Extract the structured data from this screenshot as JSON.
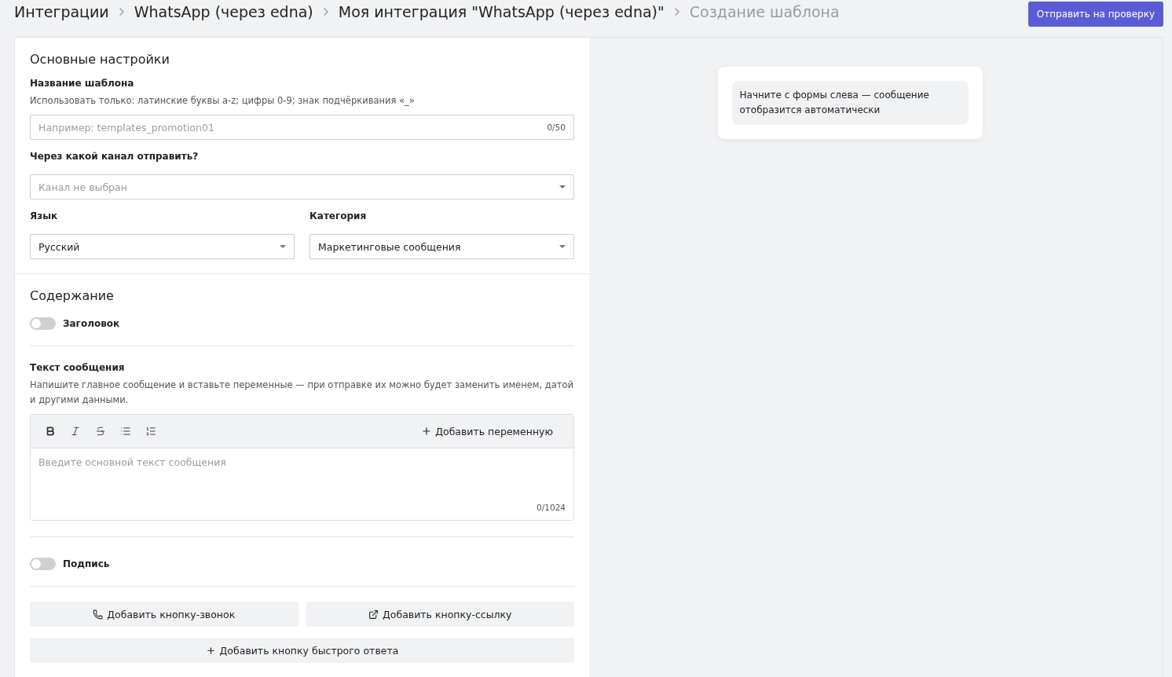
{
  "breadcrumbs": [
    {
      "label": "Интеграции",
      "current": false
    },
    {
      "label": "WhatsApp (через edna)",
      "current": false
    },
    {
      "label": "Моя интеграция \"WhatsApp (через edna)\"",
      "current": false
    },
    {
      "label": "Создание шаблона",
      "current": true
    }
  ],
  "submit_button": "Отправить на проверку",
  "basic_settings": {
    "title": "Основные настройки",
    "name_field": {
      "label": "Название шаблона",
      "hint": "Использовать только: латинские буквы a-z; цифры 0-9; знак подчёркивания «_»",
      "placeholder": "Например: templates_promotion01",
      "counter": "0/50"
    },
    "channel_field": {
      "label": "Через какой канал отправить?",
      "placeholder": "Канал не выбран"
    },
    "language_field": {
      "label": "Язык",
      "value": "Русский"
    },
    "category_field": {
      "label": "Категория",
      "value": "Маркетинговые сообщения"
    }
  },
  "content": {
    "title": "Содержание",
    "header_toggle": {
      "label": "Заголовок",
      "on": false
    },
    "message": {
      "label": "Текст сообщения",
      "hint": "Напишите главное сообщение и вставьте переменные — при отправке их можно будет заменить именем, датой и другими данными.",
      "toolbar": [
        {
          "kind": "bold"
        },
        {
          "kind": "italic"
        },
        {
          "kind": "strike"
        },
        {
          "kind": "bullets"
        },
        {
          "kind": "numbered"
        }
      ],
      "add_variable": "Добавить переменную",
      "placeholder": "Введите основной текст сообщения",
      "counter": "0/1024"
    },
    "signature_toggle": {
      "label": "Подпись",
      "on": false
    },
    "buttons": [
      {
        "kind": "call",
        "label": "Добавить кнопку-звонок"
      },
      {
        "kind": "link",
        "label": "Добавить кнопку-ссылку"
      },
      {
        "kind": "quick",
        "label": "Добавить кнопку быстрого ответа"
      }
    ]
  },
  "preview": {
    "text": "Начните с формы слева — сообщение отобразится автоматически"
  }
}
